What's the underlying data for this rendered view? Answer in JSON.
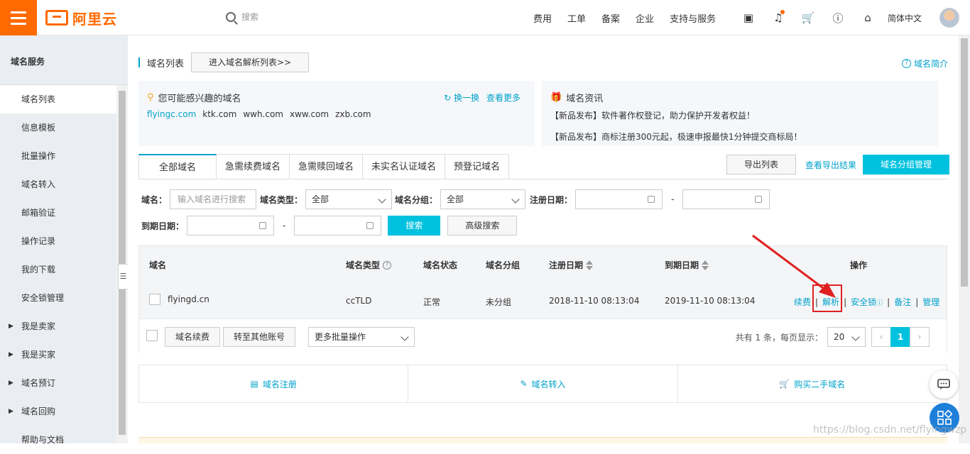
{
  "topbar": {
    "logo_text": "阿里云",
    "search_placeholder": "搜索",
    "nav": [
      "费用",
      "工单",
      "备案",
      "企业",
      "支持与服务"
    ],
    "icons": [
      "terminal-icon",
      "bell-icon",
      "cart-icon",
      "help-icon",
      "home-icon"
    ],
    "language": "简体中文"
  },
  "sidebar": {
    "heading": "域名服务",
    "items": [
      {
        "label": "域名列表",
        "active": true
      },
      {
        "label": "信息模板"
      },
      {
        "label": "批量操作"
      },
      {
        "label": "域名转入"
      },
      {
        "label": "邮箱验证"
      },
      {
        "label": "操作记录"
      },
      {
        "label": "我的下载"
      },
      {
        "label": "安全锁管理"
      },
      {
        "label": "我是卖家",
        "expandable": true
      },
      {
        "label": "我是买家",
        "expandable": true
      },
      {
        "label": "域名预订",
        "expandable": true
      },
      {
        "label": "域名回购",
        "expandable": true
      },
      {
        "label": "帮助与文档"
      }
    ]
  },
  "header": {
    "title": "域名列表",
    "dns_button": "进入域名解析列表>>",
    "intro_link": "域名简介"
  },
  "suggest_panel": {
    "title": "您可能感兴趣的域名",
    "refresh": "换一换",
    "more": "查看更多",
    "domains": [
      "flyingc.com",
      "ktk.com",
      "wwh.com",
      "xww.com",
      "zxb.com"
    ]
  },
  "news_panel": {
    "title": "域名资讯",
    "items": [
      "【新品发布】软件著作权登记，助力保护开发者权益！",
      "【新品发布】商标注册300元起，极速申报最快1分钟提交商标局！"
    ]
  },
  "tabs": [
    "全部域名",
    "急需续费域名",
    "急需赎回域名",
    "未实名认证域名",
    "预登记域名"
  ],
  "toolbar": {
    "export_list": "导出列表",
    "view_export": "查看导出结果",
    "group_manage": "域名分组管理"
  },
  "filters": {
    "domain_label": "域名：",
    "domain_placeholder": "输入域名进行搜索",
    "type_label": "域名类型：",
    "type_value": "全部",
    "group_label": "域名分组：",
    "group_value": "全部",
    "reg_label": "注册日期：",
    "exp_label": "到期日期：",
    "dash": "-",
    "search_button": "搜索",
    "advanced_button": "高级搜索"
  },
  "table": {
    "columns": [
      "域名",
      "域名类型",
      "域名状态",
      "域名分组",
      "注册日期",
      "到期日期",
      "操作"
    ],
    "rows": [
      {
        "domain": "flyingd.cn",
        "type": "ccTLD",
        "status": "正常",
        "group": "未分组",
        "reg_date": "2018-11-10 08:13:04",
        "exp_date": "2019-11-10 08:13:04",
        "ops": [
          "续费",
          "解析",
          "安全锁",
          "备注",
          "管理"
        ]
      }
    ]
  },
  "footer": {
    "renew_button": "域名续费",
    "transfer_button": "转至其他账号",
    "batch_select": "更多批量操作",
    "summary": "共有 1 条，每页显示：",
    "page_size": "20",
    "current_page": "1"
  },
  "quick_links": [
    "域名注册",
    "域名转入",
    "购买二手域名"
  ],
  "watermark": "https://blog.csdn.net/flyingwzp",
  "colors": {
    "brand": "#ff6a00",
    "accent": "#00c1de",
    "link": "#00a2ca",
    "highlight": "#e02020"
  }
}
